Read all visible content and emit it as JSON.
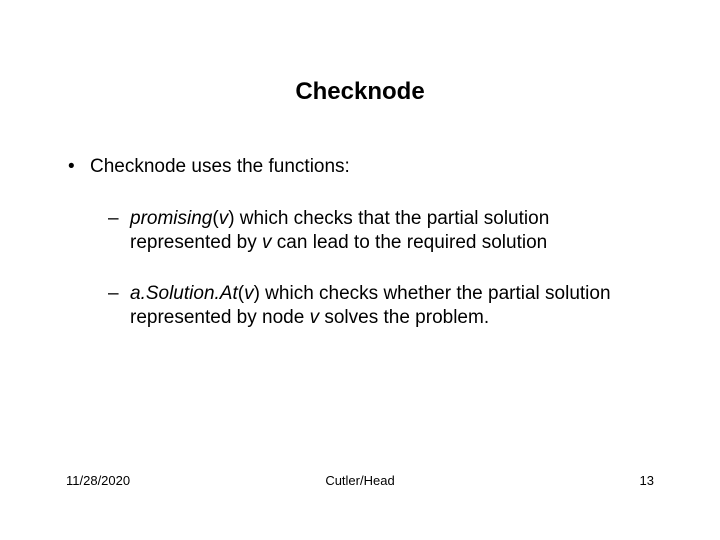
{
  "title": "Checknode",
  "bullets": {
    "l1": "Checknode uses  the functions:",
    "l2a_em1": "promising",
    "l2a_p1": "(",
    "l2a_v1": "v",
    "l2a_p2": ") which checks that the partial solution represented by ",
    "l2a_v2": "v",
    "l2a_p3": " can lead to the required solution",
    "l2b_em1": "a.Solution.At",
    "l2b_p1": "(",
    "l2b_v1": "v",
    "l2b_p2": ") which checks whether the partial solution represented by node ",
    "l2b_v2": "v",
    "l2b_p3": " solves the problem."
  },
  "footer": {
    "date": "11/28/2020",
    "author": "Cutler/Head",
    "page": "13"
  }
}
